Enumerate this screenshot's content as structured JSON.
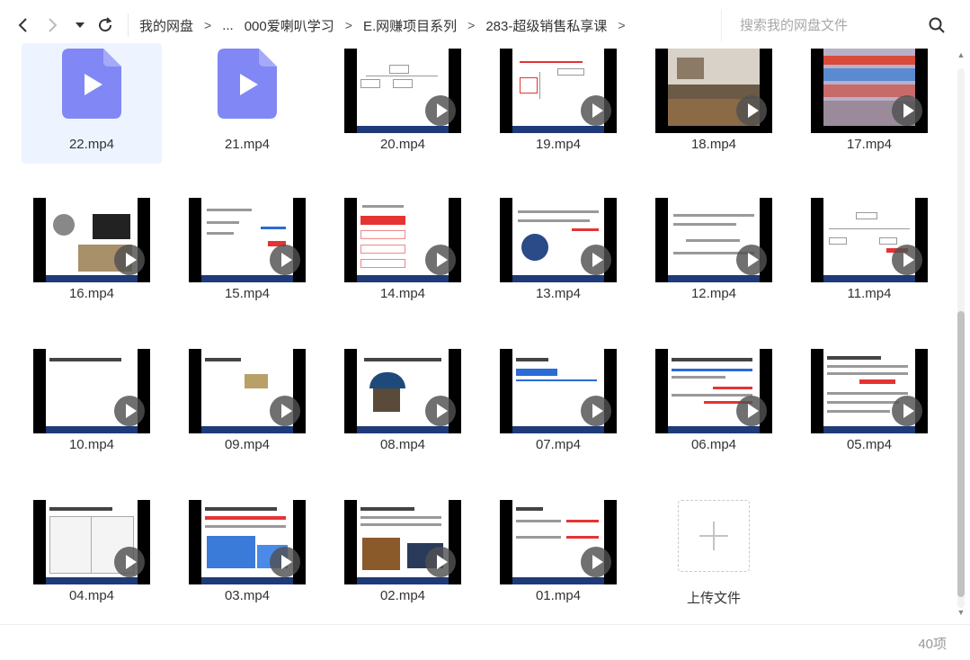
{
  "nav": {
    "breadcrumbs": [
      "我的网盘",
      "...",
      "000爱喇叭学习",
      "E.网赚项目系列",
      "283-超级销售私享课"
    ],
    "separator": ">"
  },
  "search": {
    "placeholder": "搜索我的网盘文件"
  },
  "files": [
    "22.mp4",
    "21.mp4",
    "20.mp4",
    "19.mp4",
    "18.mp4",
    "17.mp4",
    "16.mp4",
    "15.mp4",
    "14.mp4",
    "13.mp4",
    "12.mp4",
    "11.mp4",
    "10.mp4",
    "09.mp4",
    "08.mp4",
    "07.mp4",
    "06.mp4",
    "05.mp4",
    "04.mp4",
    "03.mp4",
    "02.mp4",
    "01.mp4"
  ],
  "upload": {
    "label": "上传文件"
  },
  "status": {
    "count": "40项"
  },
  "colors": {
    "file_icon": "#8187f4",
    "selected_bg": "#edf4ff",
    "slide_footer": "#1e3a78",
    "accent_red": "#e53333"
  }
}
